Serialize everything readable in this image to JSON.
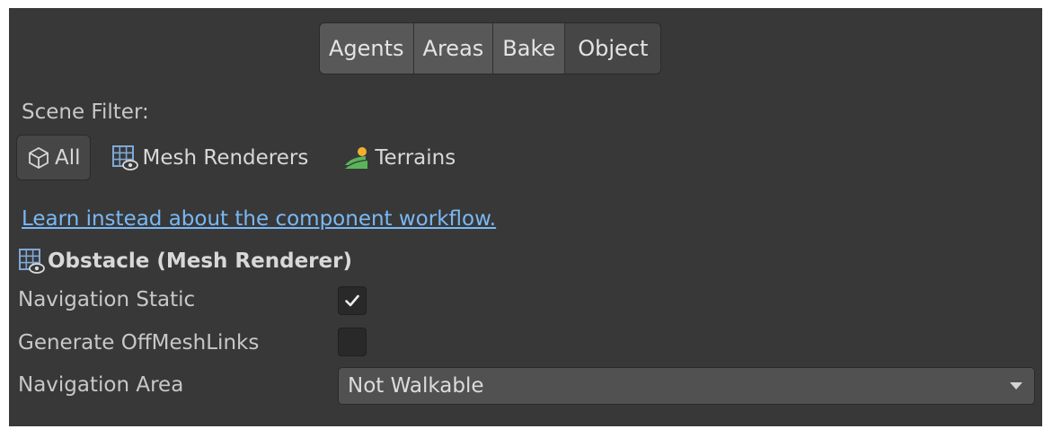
{
  "tabs": [
    {
      "label": "Agents",
      "active": false
    },
    {
      "label": "Areas",
      "active": false
    },
    {
      "label": "Bake",
      "active": false
    },
    {
      "label": "Object",
      "active": true
    }
  ],
  "scene_filter": {
    "label": "Scene Filter:",
    "options": [
      {
        "label": "All",
        "icon": "cube-icon",
        "selected": true
      },
      {
        "label": "Mesh Renderers",
        "icon": "mesh-renderer-icon",
        "selected": false
      },
      {
        "label": "Terrains",
        "icon": "terrain-icon",
        "selected": false
      }
    ]
  },
  "workflow_link": "Learn instead about the component workflow.",
  "object": {
    "icon": "mesh-renderer-icon",
    "title": "Obstacle (Mesh Renderer)"
  },
  "fields": {
    "navigation_static": {
      "label": "Navigation Static",
      "checked": true
    },
    "generate_offmeshlinks": {
      "label": "Generate OffMeshLinks",
      "checked": false
    },
    "navigation_area": {
      "label": "Navigation Area",
      "value": "Not Walkable"
    }
  },
  "colors": {
    "panel_bg": "#383838",
    "link": "#7ab8f5",
    "terrain_green": "#5ab55a",
    "terrain_sun": "#f0b030",
    "mesh_icon_blue": "#7fa8d8"
  }
}
